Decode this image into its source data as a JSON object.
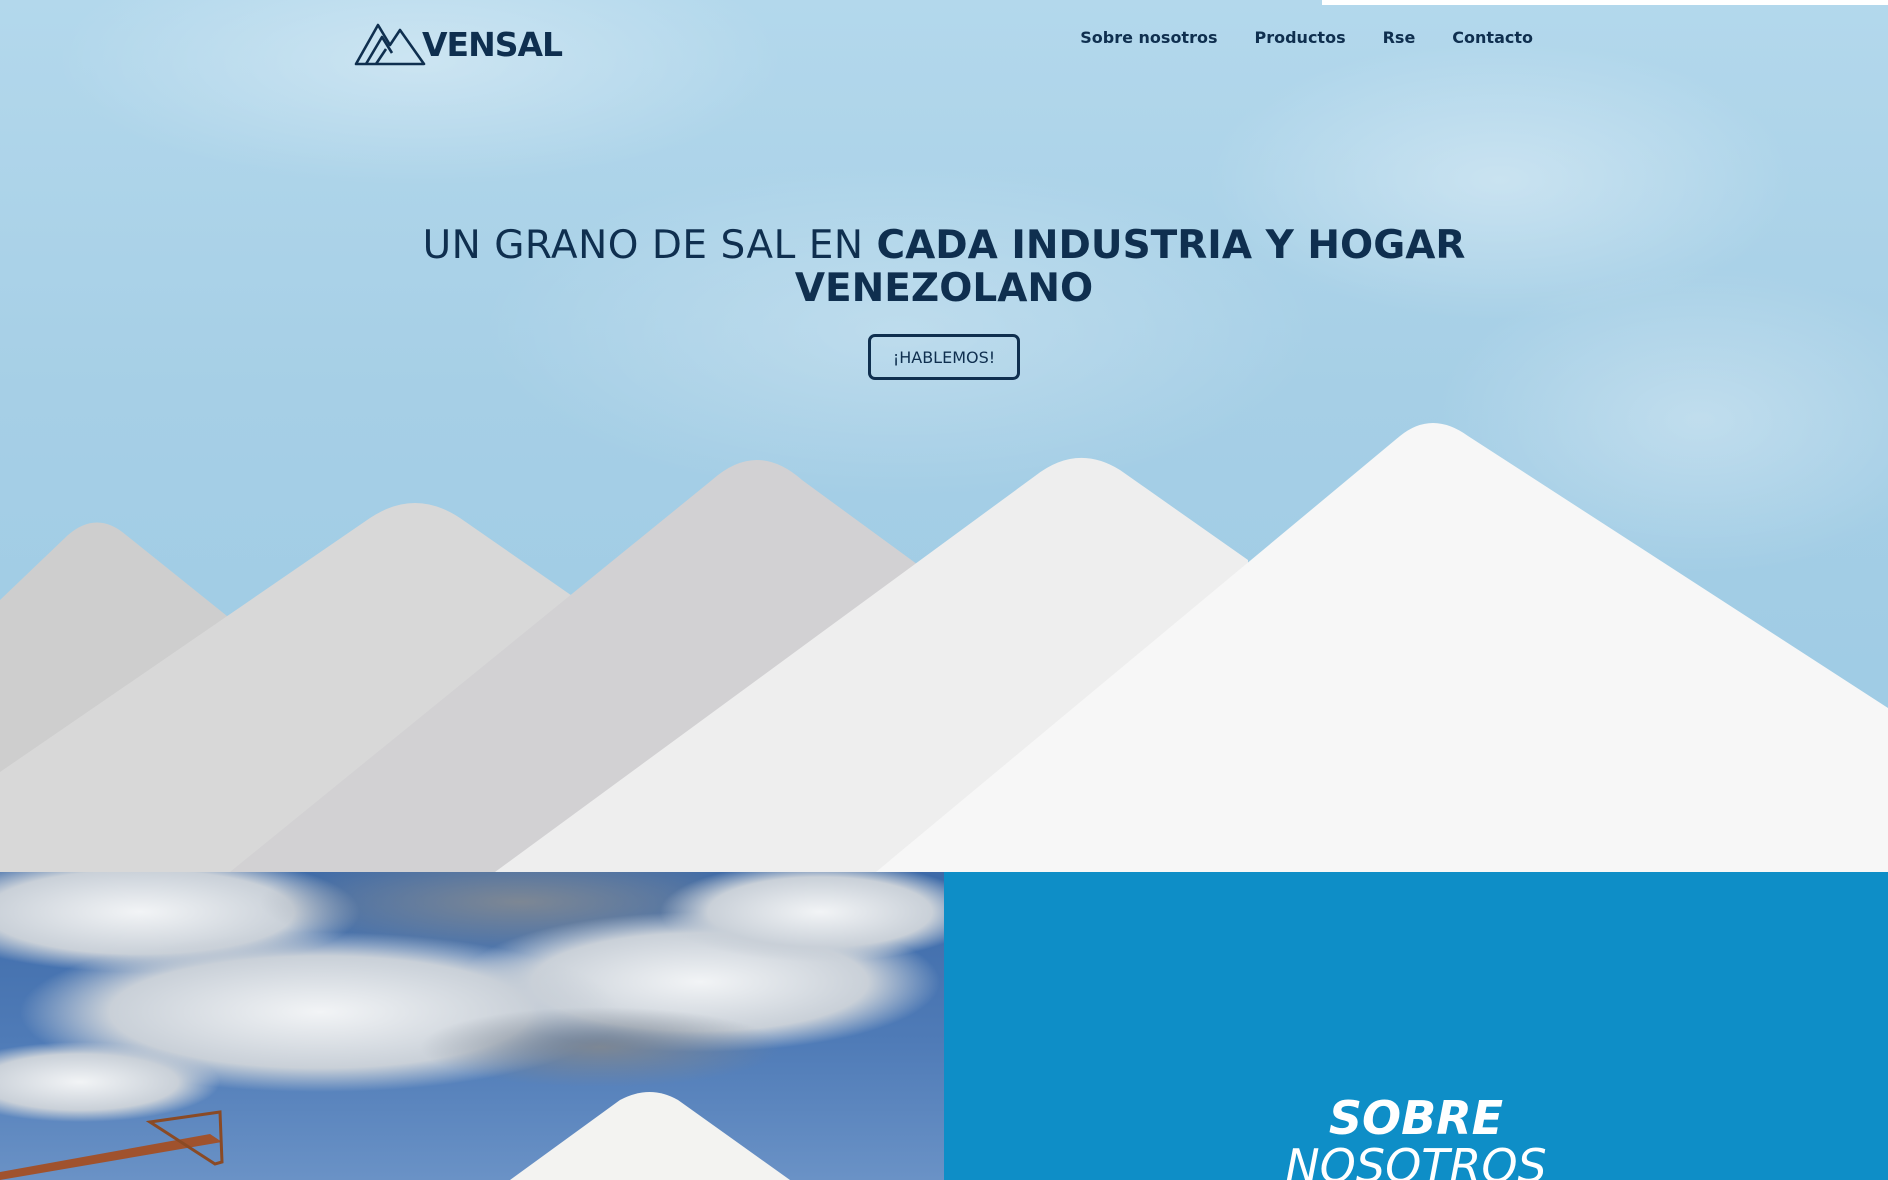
{
  "brand": {
    "name": "VENSAL"
  },
  "nav": {
    "items": [
      "Sobre nosotros",
      "Productos",
      "Rse",
      "Contacto"
    ]
  },
  "hero": {
    "headline_light": "UN GRANO DE SAL EN ",
    "headline_bold": "CADA INDUSTRIA Y HOGAR VENEZOLANO",
    "cta_label": "¡HABLEMOS!"
  },
  "about": {
    "title_line1": "SOBRE",
    "title_line2": "NOSOTROS"
  },
  "colors": {
    "navy": "#0f2f4f",
    "sky": "#a6cfe6",
    "section_blue": "#0e8ec7"
  }
}
